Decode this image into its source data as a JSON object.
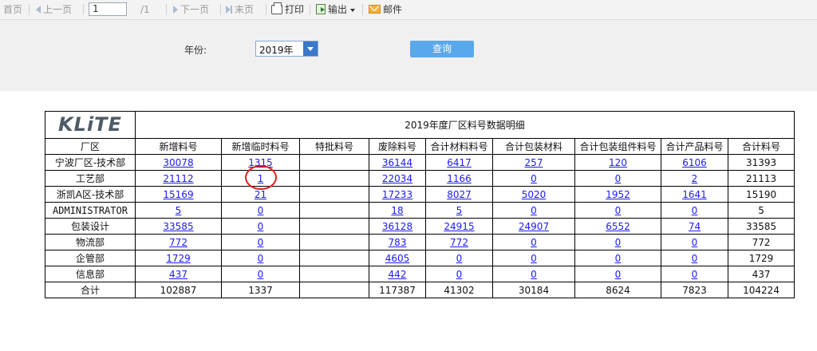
{
  "toolbar": {
    "first_page": "首页",
    "prev_page": "上一页",
    "page_number": "1",
    "page_total": "/1",
    "next_page": "下一页",
    "last_page": "末页",
    "print": "打印",
    "export": "输出",
    "mail": "邮件"
  },
  "filter": {
    "year_label": "年份:",
    "year_value": "2019年",
    "query_button": "查询"
  },
  "report": {
    "logo_text": "KLiTE",
    "title": "2019年度厂区料号数据明细",
    "columns": [
      "厂区",
      "新增料号",
      "新增临时料号",
      "特批料号",
      "废除料号",
      "合计材料料号",
      "合计包装材料",
      "合计包装组件料号",
      "合计产品料号",
      "合计料号"
    ],
    "rows": [
      {
        "name": "宁波厂区-技术部",
        "c1": "30078",
        "c2": "1315",
        "c3": "",
        "c4": "36144",
        "c5": "6417",
        "c6": "257",
        "c7": "120",
        "c8": "6106",
        "c9": "31393"
      },
      {
        "name": "工艺部",
        "c1": "21112",
        "c2": "1",
        "c3": "",
        "c4": "22034",
        "c5": "1166",
        "c6": "0",
        "c7": "0",
        "c8": "2",
        "c9": "21113"
      },
      {
        "name": "浙凯A区-技术部",
        "c1": "15169",
        "c2": "21",
        "c3": "",
        "c4": "17233",
        "c5": "8027",
        "c6": "5020",
        "c7": "1952",
        "c8": "1641",
        "c9": "15190"
      },
      {
        "name": "ADMINISTRATOR",
        "c1": "5",
        "c2": "0",
        "c3": "",
        "c4": "18",
        "c5": "5",
        "c6": "0",
        "c7": "0",
        "c8": "0",
        "c9": "5"
      },
      {
        "name": "包装设计",
        "c1": "33585",
        "c2": "0",
        "c3": "",
        "c4": "36128",
        "c5": "24915",
        "c6": "24907",
        "c7": "6552",
        "c8": "74",
        "c9": "33585"
      },
      {
        "name": "物流部",
        "c1": "772",
        "c2": "0",
        "c3": "",
        "c4": "783",
        "c5": "772",
        "c6": "0",
        "c7": "0",
        "c8": "0",
        "c9": "772"
      },
      {
        "name": "企管部",
        "c1": "1729",
        "c2": "0",
        "c3": "",
        "c4": "4605",
        "c5": "0",
        "c6": "0",
        "c7": "0",
        "c8": "0",
        "c9": "1729"
      },
      {
        "name": "信息部",
        "c1": "437",
        "c2": "0",
        "c3": "",
        "c4": "442",
        "c5": "0",
        "c6": "0",
        "c7": "0",
        "c8": "0",
        "c9": "437"
      }
    ],
    "total": {
      "name": "合计",
      "c1": "102887",
      "c2": "1337",
      "c3": "",
      "c4": "117387",
      "c5": "41302",
      "c6": "30184",
      "c7": "8624",
      "c8": "7823",
      "c9": "104224"
    }
  },
  "colors": {
    "link": "#1a1aff",
    "highlight_circle": "#e21e1e",
    "query_button": "#5aa8ec"
  }
}
